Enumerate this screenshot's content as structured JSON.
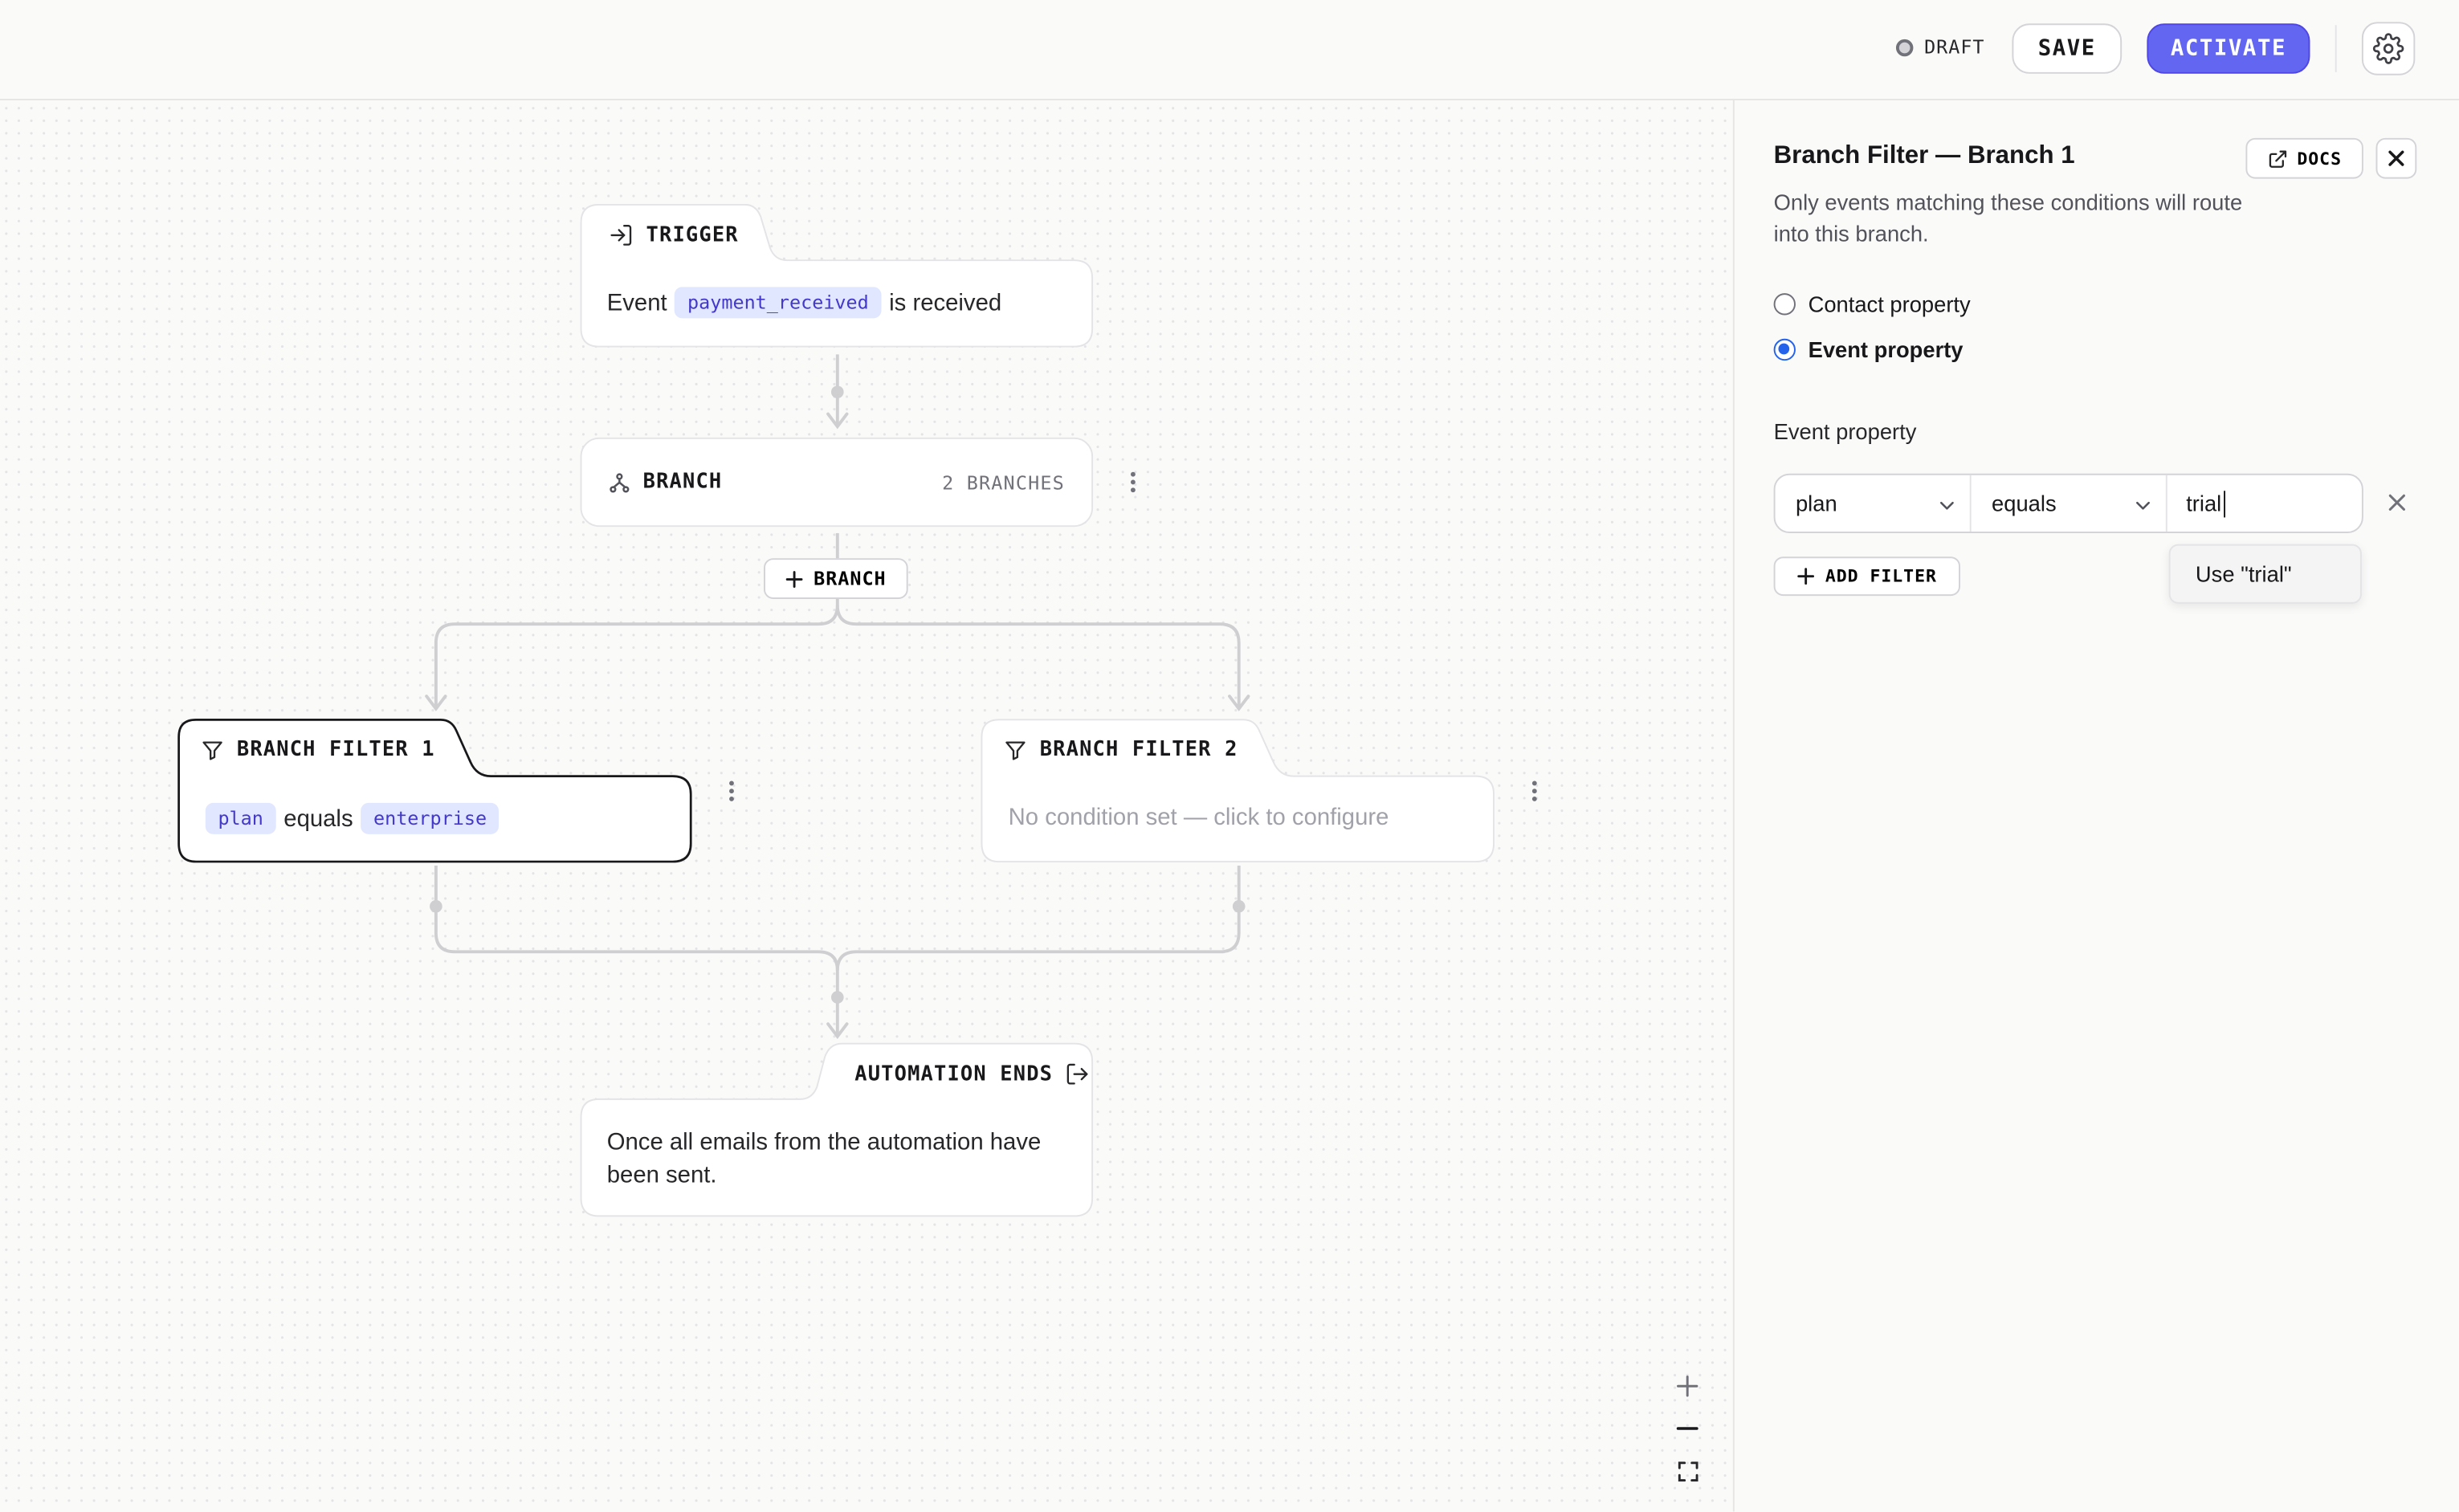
{
  "topbar": {
    "status_label": "DRAFT",
    "save_label": "SAVE",
    "activate_label": "ACTIVATE",
    "settings_icon": "gear-icon",
    "accent_color": "#6366f1"
  },
  "canvas": {
    "trigger": {
      "label": "TRIGGER",
      "icon": "enter-icon",
      "text_before": "Event",
      "event_name": "payment_received",
      "text_after": "is received"
    },
    "branch": {
      "label": "BRANCH",
      "icon": "branch-icon",
      "count": "2 BRANCHES"
    },
    "add_branch_label": "BRANCH",
    "filters": [
      {
        "label": "BRANCH FILTER 1",
        "icon": "filter-icon",
        "property": "plan",
        "operator": "equals",
        "value": "enterprise"
      },
      {
        "label": "BRANCH FILTER 2",
        "icon": "filter-icon",
        "empty_text": "No condition set — click to configure"
      }
    ],
    "end": {
      "label": "AUTOMATION ENDS",
      "icon": "exit-icon",
      "text": "Once all emails from the automation have been sent."
    },
    "zoom_controls": [
      "zoom-in",
      "zoom-out",
      "fit-view"
    ]
  },
  "panel": {
    "title": "Branch Filter — Branch 1",
    "description": "Only events matching these conditions will route into this branch.",
    "docs_label": "DOCS",
    "radio_options": [
      {
        "label": "Contact property",
        "checked": false
      },
      {
        "label": "Event property",
        "checked": true
      }
    ],
    "field_label": "Event property",
    "filter": {
      "property": "plan",
      "operator": "equals",
      "value": "trial"
    },
    "add_filter_label": "ADD FILTER",
    "suggestion": "Use \"trial\""
  }
}
